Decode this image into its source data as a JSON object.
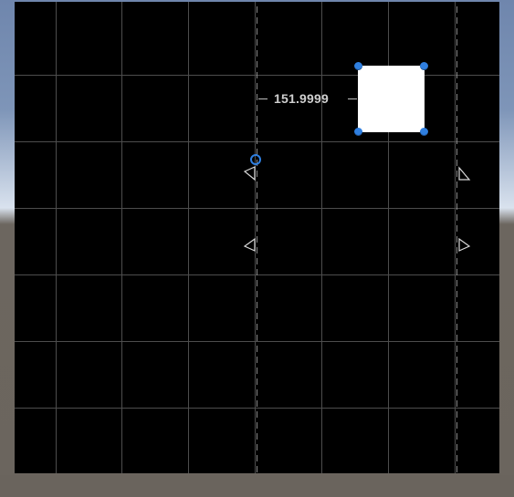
{
  "scene_view": {
    "distance_readout": "151.9999",
    "colors": {
      "canvas_background": "#000000",
      "grid_lines": "#5a5a5a",
      "guide_lines": "#8a8a8a",
      "selected_rect_fill": "#ffffff",
      "handle_blue": "#2f7fe0",
      "sky_top": "#6f86ad",
      "ground": "#6b655e"
    },
    "icons": {
      "pivot": "pivot-circle-icon",
      "anchors": "anchor-triangle-icon",
      "resize_handles": "resize-handle-icon"
    }
  }
}
